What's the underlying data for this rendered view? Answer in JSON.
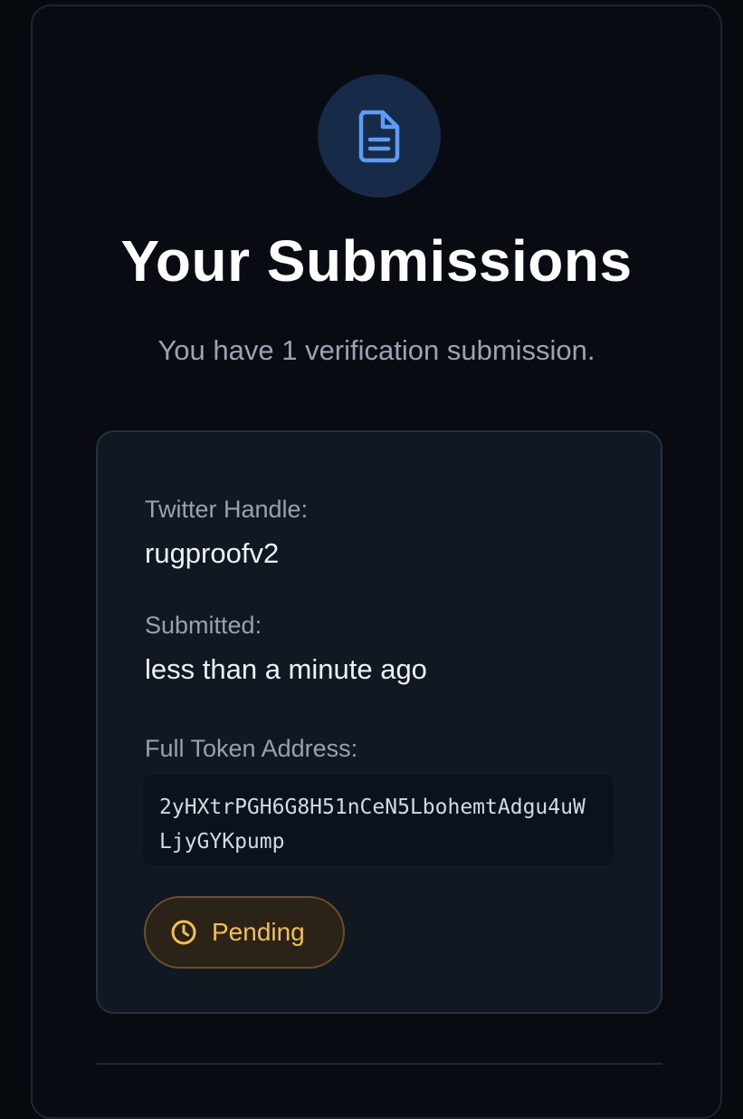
{
  "header": {
    "icon": "document-icon",
    "title": "Your Submissions",
    "subtitle": "You have 1 verification submission."
  },
  "submission": {
    "twitter_label": "Twitter Handle:",
    "twitter_value": "rugproofv2",
    "submitted_label": "Submitted:",
    "submitted_value": "less than a minute ago",
    "address_label": "Full Token Address:",
    "address_value": "2yHXtrPGH6G8H51nCeN5LbohemtAdgu4uWLjyGYKpump",
    "status_icon": "clock-icon",
    "status": "Pending"
  },
  "colors": {
    "background": "#060a0f",
    "icon_circle": "#172a47",
    "icon_stroke": "#5b9cf5",
    "pending_text": "#f2c14a",
    "pending_bg": "#2b2317"
  }
}
